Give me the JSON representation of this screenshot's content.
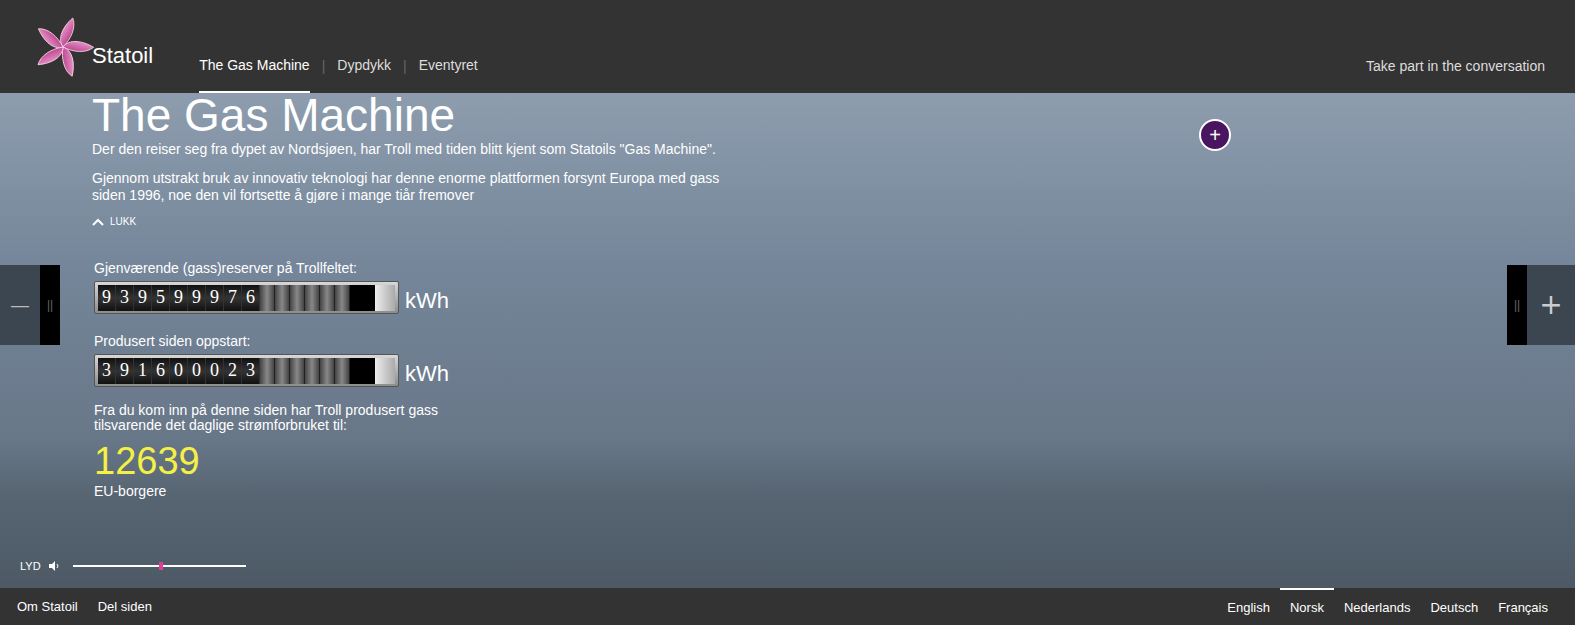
{
  "header": {
    "logo": "Statoil",
    "nav": [
      {
        "label": "The Gas Machine",
        "selected": true
      },
      {
        "label": "Dypdykk",
        "selected": false
      },
      {
        "label": "Eventyret",
        "selected": false
      }
    ],
    "nav_separator": "|",
    "cta": "Take part in the conversation"
  },
  "hero": {
    "title": "The Gas Machine",
    "paragraphs": [
      "Der den reiser seg fra dypet av Nordsjøen, har Troll med tiden blitt kjent som Statoils \"Gas Machine\".",
      "Gjennom utstrakt bruk av innovativ teknologi har denne enorme plattformen forsynt Europa med gass siden 1996, noe den vil fortsette å gjøre i mange tiår fremover"
    ],
    "collapse": "LUKK",
    "info_button": "+"
  },
  "counters": [
    {
      "label": "Gjenværende (gass)reserver på Trollfeltet:",
      "digits": "939599976",
      "unit": "kWh"
    },
    {
      "label": "Produsert siden oppstart:",
      "digits": "391600023",
      "unit": "kWh"
    }
  ],
  "equivalent": {
    "text": "Fra du kom inn på denne siden har Troll produsert gass tilsvarende det daglige strømforbruket til:",
    "value": "12639",
    "unit": "EU-borgere"
  },
  "side_nav": {
    "prev": "—",
    "next": "+"
  },
  "sound": {
    "label": "LYD",
    "level": 0.5
  },
  "footer": {
    "links": [
      "Om Statoil",
      "Del siden"
    ],
    "languages": [
      {
        "label": "English",
        "selected": false
      },
      {
        "label": "Norsk",
        "selected": true
      },
      {
        "label": "Nederlands",
        "selected": false
      },
      {
        "label": "Deutsch",
        "selected": false
      },
      {
        "label": "Français",
        "selected": false
      }
    ]
  }
}
